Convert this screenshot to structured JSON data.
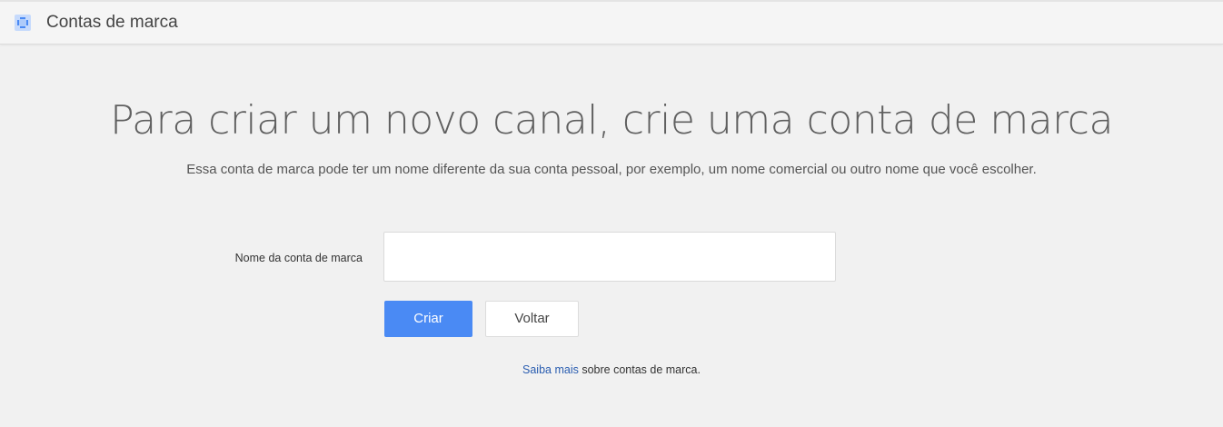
{
  "header": {
    "title": "Contas de marca",
    "icon": "brand-account-icon"
  },
  "main": {
    "headline": "Para criar um novo canal, crie uma conta de marca",
    "subtitle": "Essa conta de marca pode ter um nome diferente da sua conta pessoal, por exemplo, um nome comercial ou outro nome que você escolher.",
    "form": {
      "name_label": "Nome da conta de marca",
      "name_value": "",
      "name_placeholder": ""
    },
    "buttons": {
      "create_label": "Criar",
      "back_label": "Voltar"
    },
    "learn_more": {
      "link_text": "Saiba mais",
      "suffix_text": " sobre contas de marca."
    }
  },
  "colors": {
    "accent": "#4a8af4",
    "link": "#2a5db0",
    "background": "#f1f1f1"
  }
}
